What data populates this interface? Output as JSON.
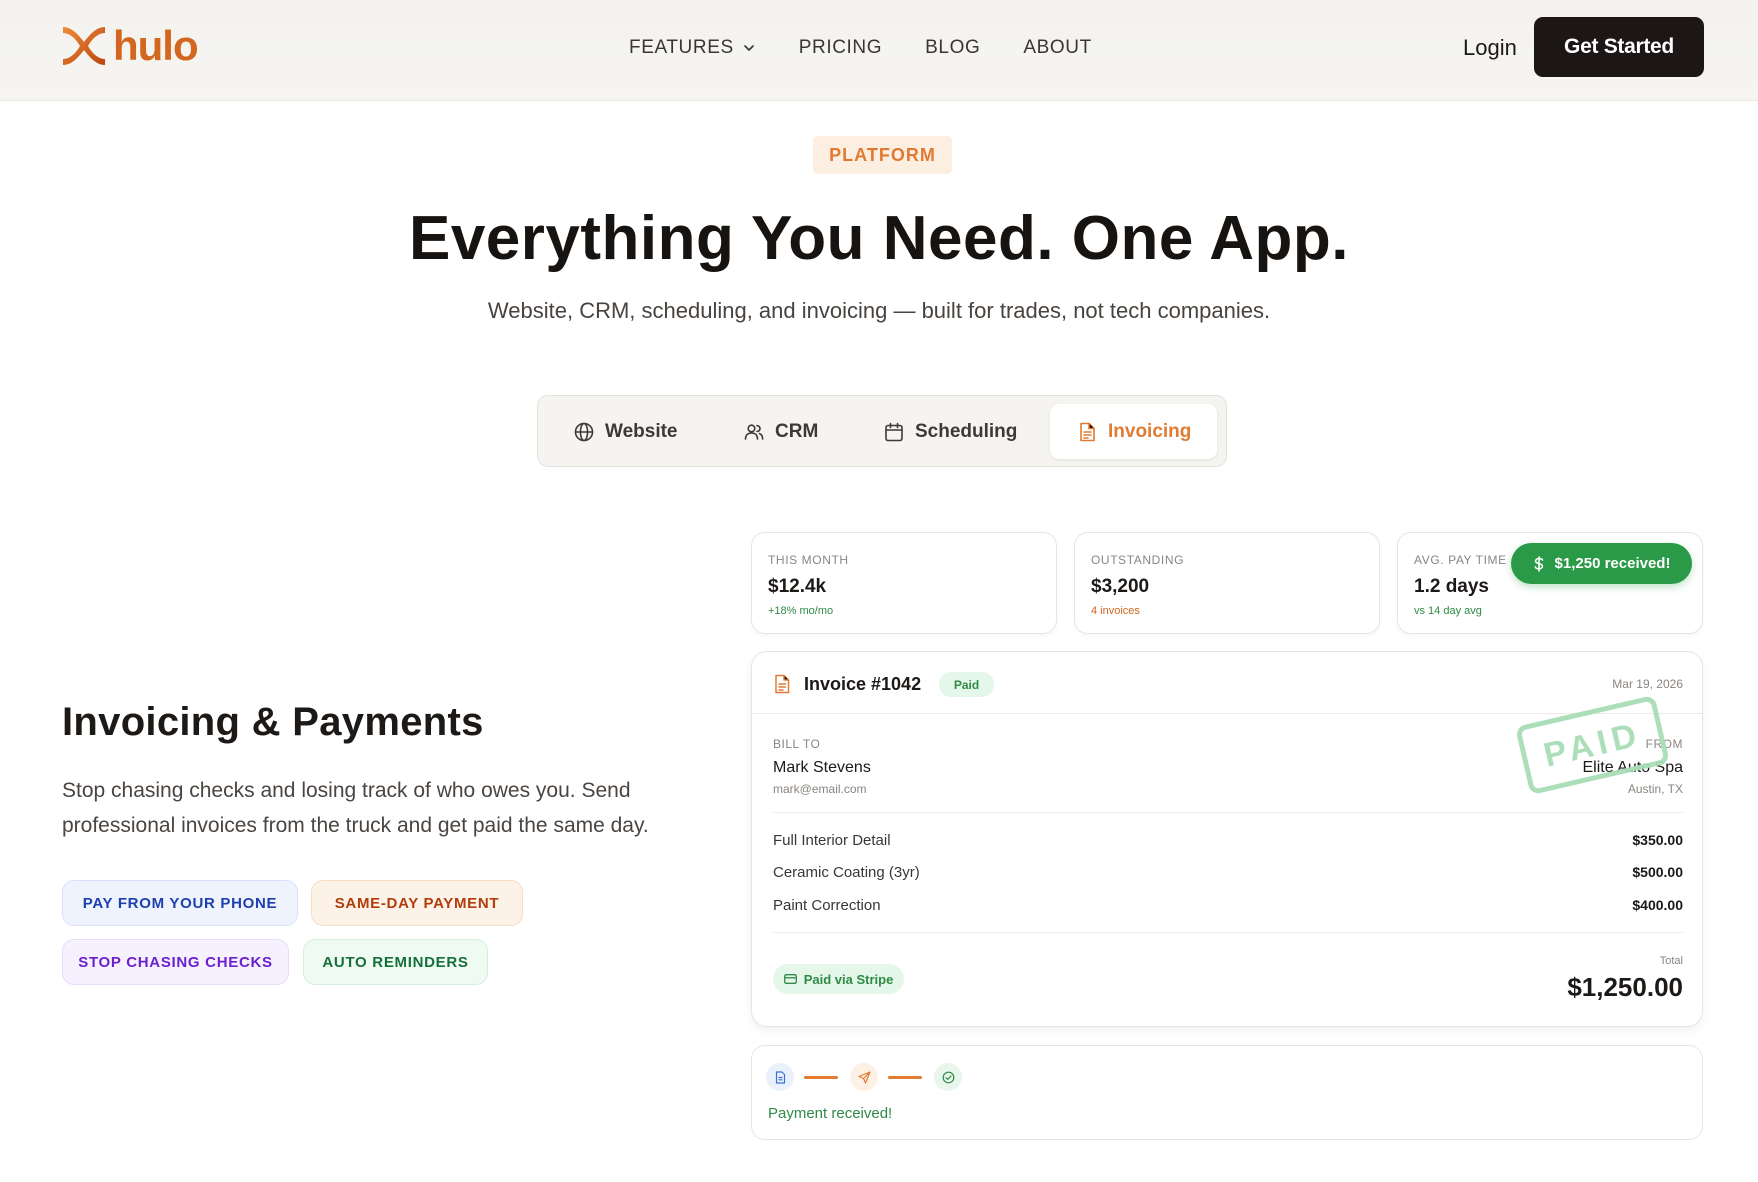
{
  "brand": {
    "name": "hulo",
    "color": "#d4671f"
  },
  "nav": {
    "items": [
      {
        "label": "FEATURES",
        "has_dropdown": true
      },
      {
        "label": "PRICING"
      },
      {
        "label": "BLOG"
      },
      {
        "label": "ABOUT"
      }
    ],
    "login": "Login",
    "cta": "Get Started"
  },
  "hero": {
    "badge": "PLATFORM",
    "title": "Everything You Need. One App.",
    "subtitle": "Website, CRM, scheduling, and invoicing — built for trades, not tech companies."
  },
  "tabs": [
    {
      "label": "Website",
      "icon": "globe-icon",
      "active": false
    },
    {
      "label": "CRM",
      "icon": "users-icon",
      "active": false
    },
    {
      "label": "Scheduling",
      "icon": "calendar-icon",
      "active": false
    },
    {
      "label": "Invoicing",
      "icon": "document-icon",
      "active": true
    }
  ],
  "feature": {
    "title": "Invoicing & Payments",
    "description": "Stop chasing checks and losing track of who owes you. Send professional invoices from the truck and get paid the same day.",
    "pills": [
      {
        "label": "PAY FROM YOUR PHONE"
      },
      {
        "label": "SAME-DAY PAYMENT"
      },
      {
        "label": "STOP CHASING CHECKS"
      },
      {
        "label": "AUTO REMINDERS"
      }
    ]
  },
  "stats": [
    {
      "label": "THIS MONTH",
      "value": "$12.4k",
      "sub": "+18% mo/mo"
    },
    {
      "label": "OUTSTANDING",
      "value": "$3,200",
      "sub": "4 invoices"
    },
    {
      "label": "AVG. PAY TIME",
      "value": "1.2 days",
      "sub": "vs 14 day avg"
    }
  ],
  "notification": {
    "icon": "dollar-icon",
    "text": "$1,250 received!"
  },
  "invoice": {
    "title": "Invoice #1042",
    "status": "Paid",
    "date": "Mar 19, 2026",
    "stamp": "PAID",
    "bill_to": {
      "label": "BILL TO",
      "name": "Mark Stevens",
      "email": "mark@email.com"
    },
    "from": {
      "label": "FROM",
      "name": "Elite Auto Spa",
      "location": "Austin, TX"
    },
    "items": [
      {
        "name": "Full Interior Detail",
        "amount": "$350.00"
      },
      {
        "name": "Ceramic Coating (3yr)",
        "amount": "$500.00"
      },
      {
        "name": "Paint Correction",
        "amount": "$400.00"
      }
    ],
    "payment_method": "Paid via Stripe",
    "total_label": "Total",
    "total": "$1,250.00"
  },
  "progress": {
    "steps": [
      "document-icon",
      "send-icon",
      "check-circle-icon"
    ],
    "message": "Payment received!"
  },
  "colors": {
    "accent": "#e07b33",
    "dark": "#1c1716",
    "success": "#2b9a48"
  }
}
